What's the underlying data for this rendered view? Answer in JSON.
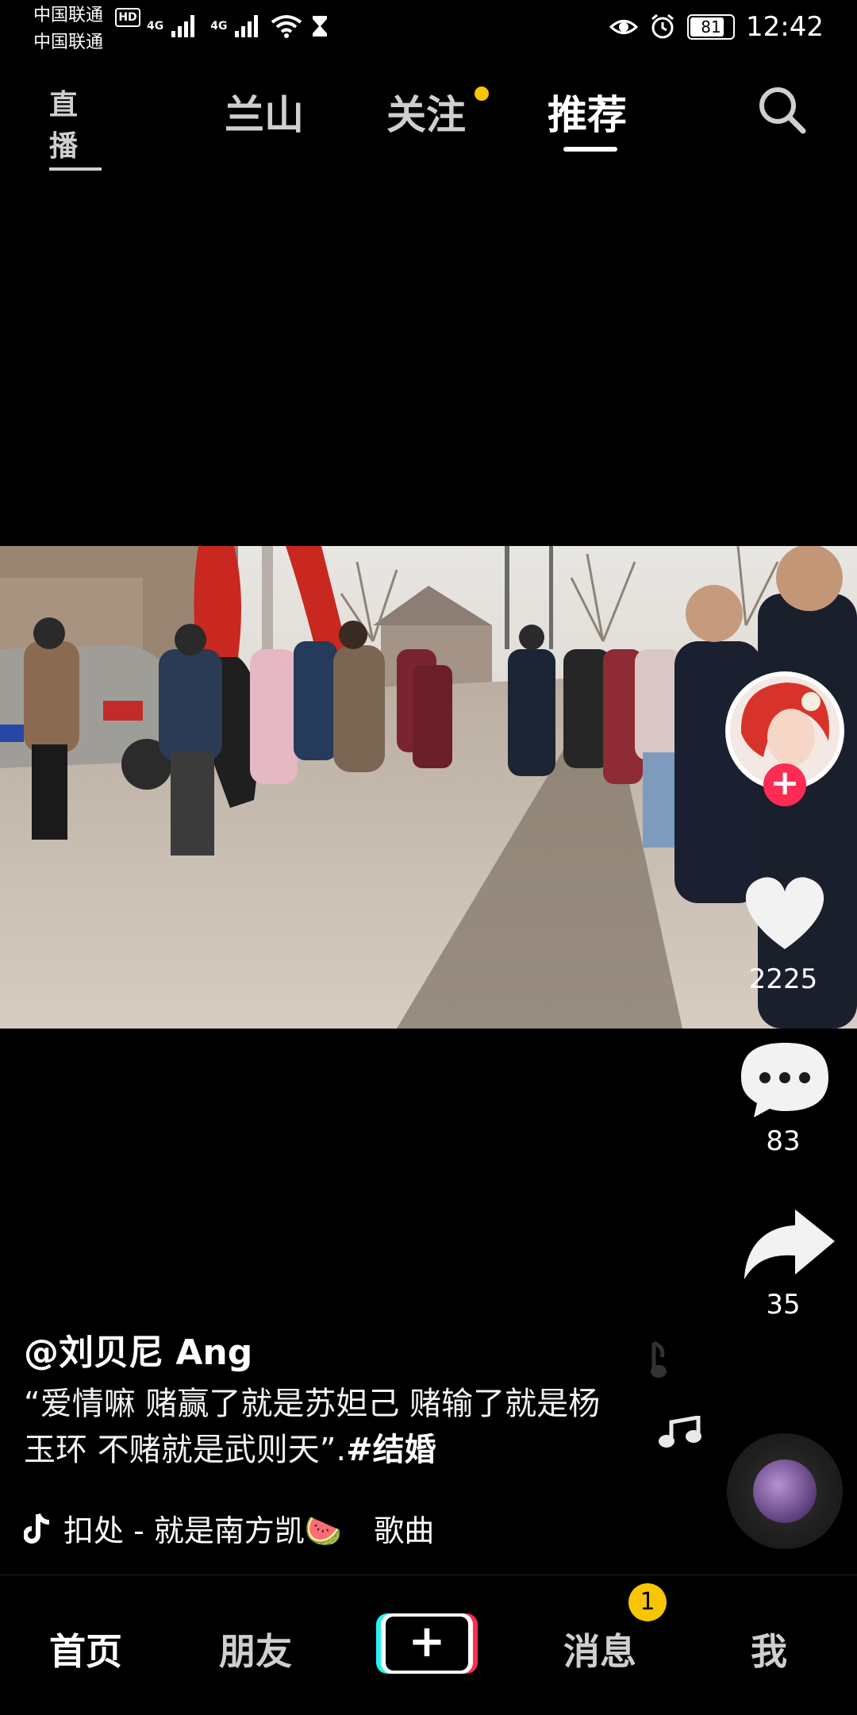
{
  "status_bar": {
    "carrier1": "中国联通",
    "carrier2": "中国联通",
    "hd": "HD",
    "net1": "4G",
    "net2": "4G",
    "battery": "81",
    "time": "12:42"
  },
  "top_nav": {
    "live": "直播",
    "tabs": [
      {
        "label": "兰山"
      },
      {
        "label": "关注"
      },
      {
        "label": "推荐"
      }
    ]
  },
  "actions": {
    "likes": "2225",
    "comments": "83",
    "shares": "35"
  },
  "post": {
    "author": "@刘贝尼 Ang",
    "description": "“爱情嘛 赌赢了就是苏妲己 赌输了就是杨玉环 不赌就是武则天”.",
    "hashtag": "#结婚",
    "music": "扣处 - 就是南方凯🍉",
    "music_suffix": "歌曲"
  },
  "bottom_nav": {
    "home": "首页",
    "friends": "朋友",
    "messages": "消息",
    "messages_badge": "1",
    "me": "我"
  },
  "colors": {
    "accent_yellow": "#f7c600",
    "follow_red": "#fe2c55"
  }
}
